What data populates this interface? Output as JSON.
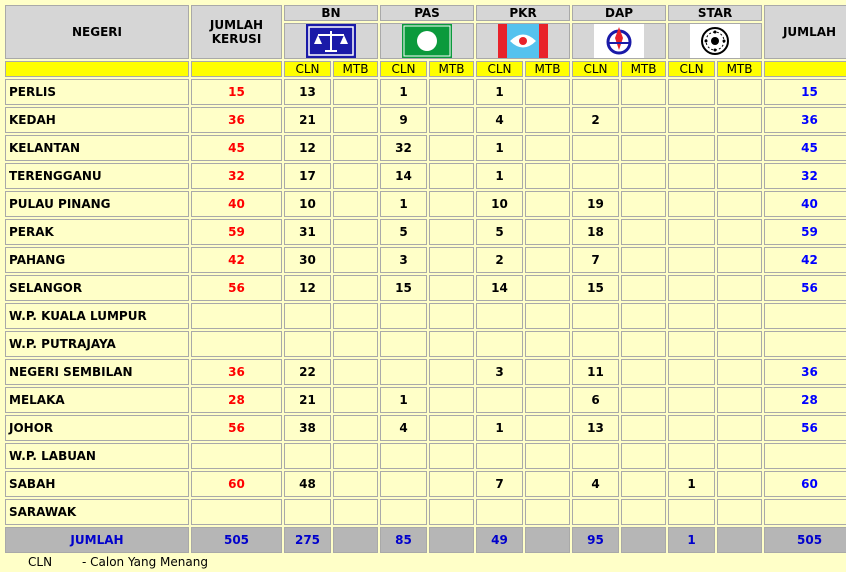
{
  "header": {
    "state": "NEGERI",
    "seats_line1": "JUMLAH",
    "seats_line2": "KERUSI",
    "total": "JUMLAH",
    "sub_cln": "CLN",
    "sub_mtb": "MTB"
  },
  "parties": [
    {
      "name": "BN",
      "icon": "bn-scales-logo"
    },
    {
      "name": "PAS",
      "icon": "pas-moon-logo"
    },
    {
      "name": "PKR",
      "icon": "pkr-eye-logo"
    },
    {
      "name": "DAP",
      "icon": "dap-rocket-logo"
    },
    {
      "name": "STAR",
      "icon": "star-emblem-logo"
    }
  ],
  "rows": [
    {
      "state": "PERLIS",
      "seats": "15",
      "bn": "13",
      "pas": "1",
      "pkr": "1",
      "dap": "",
      "star": "",
      "total": "15"
    },
    {
      "state": "KEDAH",
      "seats": "36",
      "bn": "21",
      "pas": "9",
      "pkr": "4",
      "dap": "2",
      "star": "",
      "total": "36"
    },
    {
      "state": "KELANTAN",
      "seats": "45",
      "bn": "12",
      "pas": "32",
      "pkr": "1",
      "dap": "",
      "star": "",
      "total": "45"
    },
    {
      "state": "TERENGGANU",
      "seats": "32",
      "bn": "17",
      "pas": "14",
      "pkr": "1",
      "dap": "",
      "star": "",
      "total": "32"
    },
    {
      "state": "PULAU PINANG",
      "seats": "40",
      "bn": "10",
      "pas": "1",
      "pkr": "10",
      "dap": "19",
      "star": "",
      "total": "40"
    },
    {
      "state": "PERAK",
      "seats": "59",
      "bn": "31",
      "pas": "5",
      "pkr": "5",
      "dap": "18",
      "star": "",
      "total": "59"
    },
    {
      "state": "PAHANG",
      "seats": "42",
      "bn": "30",
      "pas": "3",
      "pkr": "2",
      "dap": "7",
      "star": "",
      "total": "42"
    },
    {
      "state": "SELANGOR",
      "seats": "56",
      "bn": "12",
      "pas": "15",
      "pkr": "14",
      "dap": "15",
      "star": "",
      "total": "56"
    },
    {
      "state": "W.P. KUALA LUMPUR",
      "seats": "",
      "bn": "",
      "pas": "",
      "pkr": "",
      "dap": "",
      "star": "",
      "total": ""
    },
    {
      "state": "W.P. PUTRAJAYA",
      "seats": "",
      "bn": "",
      "pas": "",
      "pkr": "",
      "dap": "",
      "star": "",
      "total": ""
    },
    {
      "state": "NEGERI SEMBILAN",
      "seats": "36",
      "bn": "22",
      "pas": "",
      "pkr": "3",
      "dap": "11",
      "star": "",
      "total": "36"
    },
    {
      "state": "MELAKA",
      "seats": "28",
      "bn": "21",
      "pas": "1",
      "pkr": "",
      "dap": "6",
      "star": "",
      "total": "28"
    },
    {
      "state": "JOHOR",
      "seats": "56",
      "bn": "38",
      "pas": "4",
      "pkr": "1",
      "dap": "13",
      "star": "",
      "total": "56"
    },
    {
      "state": "W.P. LABUAN",
      "seats": "",
      "bn": "",
      "pas": "",
      "pkr": "",
      "dap": "",
      "star": "",
      "total": ""
    },
    {
      "state": "SABAH",
      "seats": "60",
      "bn": "48",
      "pas": "",
      "pkr": "7",
      "dap": "4",
      "star": "1",
      "total": "60"
    },
    {
      "state": "SARAWAK",
      "seats": "",
      "bn": "",
      "pas": "",
      "pkr": "",
      "dap": "",
      "star": "",
      "total": ""
    }
  ],
  "totals": {
    "label": "JUMLAH",
    "seats": "505",
    "bn": "275",
    "pas": "85",
    "pkr": "49",
    "dap": "95",
    "star": "1",
    "total": "505"
  },
  "footnote": {
    "abbr": "CLN",
    "definition": "- Calon Yang Menang"
  },
  "colors": {
    "page_bg": "#ffffc8",
    "header_bg": "#d6d6d6",
    "subheader_bg": "#ffff00",
    "seats_text": "#ff0000",
    "total_text": "#0000ff",
    "totals_row_bg": "#b6b6b6"
  }
}
